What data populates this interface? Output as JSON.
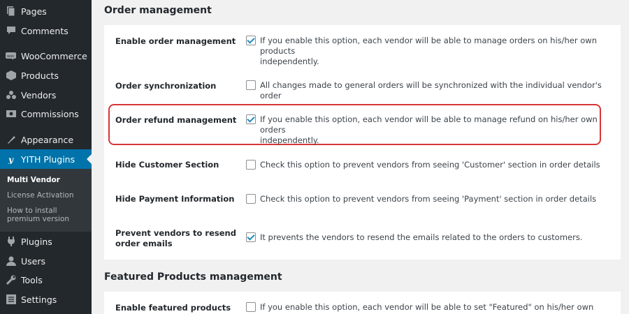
{
  "sidebar": {
    "items": [
      {
        "label": "Pages",
        "icon": "pages-icon"
      },
      {
        "label": "Comments",
        "icon": "comments-icon"
      },
      {
        "label": "WooCommerce",
        "icon": "woocommerce-icon"
      },
      {
        "label": "Products",
        "icon": "products-icon"
      },
      {
        "label": "Vendors",
        "icon": "vendors-icon"
      },
      {
        "label": "Commissions",
        "icon": "commissions-icon"
      },
      {
        "label": "Appearance",
        "icon": "appearance-icon"
      },
      {
        "label": "YITH Plugins",
        "icon": "yith-icon"
      },
      {
        "label": "Plugins",
        "icon": "plugins-icon"
      },
      {
        "label": "Users",
        "icon": "users-icon"
      },
      {
        "label": "Tools",
        "icon": "tools-icon"
      },
      {
        "label": "Settings",
        "icon": "settings-icon"
      }
    ],
    "submenu": {
      "multi_vendor": "Multi Vendor",
      "license_activation": "License Activation",
      "how_to_install_1": "How to install",
      "how_to_install_2": "premium version"
    }
  },
  "order_management": {
    "title": "Order management",
    "rows": [
      {
        "label": "Enable order management",
        "checked": true,
        "desc_1": "If you enable this option, each vendor will be able to manage orders on his/her own products",
        "desc_2": "independently."
      },
      {
        "label": "Order synchronization",
        "checked": false,
        "desc_1": "All changes made to general orders will be synchronized with the individual vendor's order"
      },
      {
        "label": "Order refund management",
        "checked": true,
        "desc_1": "If you enable this option, each vendor will be able to manage refund on his/her own orders",
        "desc_2": "independently."
      },
      {
        "label": "Hide Customer Section",
        "checked": false,
        "desc_1": "Check this option to prevent vendors from seeing 'Customer' section in order details"
      },
      {
        "label": "Hide Payment Information",
        "checked": false,
        "desc_1": "Check this option to prevent vendors from seeing 'Payment' section in order details"
      },
      {
        "label_1": "Prevent vendors to resend",
        "label_2": "order emails",
        "checked": true,
        "desc_1": "It prevents the vendors to resend the emails related to the orders to customers."
      }
    ]
  },
  "featured_products": {
    "title": "Featured Products management",
    "rows": [
      {
        "label": "Enable featured products",
        "checked": false,
        "desc_1": "If you enable this option, each vendor will be able to set \"Featured\" on his/her own products"
      }
    ]
  },
  "colors": {
    "sidebar_bg": "#23282d",
    "active": "#0073aa",
    "highlight": "#d63638"
  }
}
